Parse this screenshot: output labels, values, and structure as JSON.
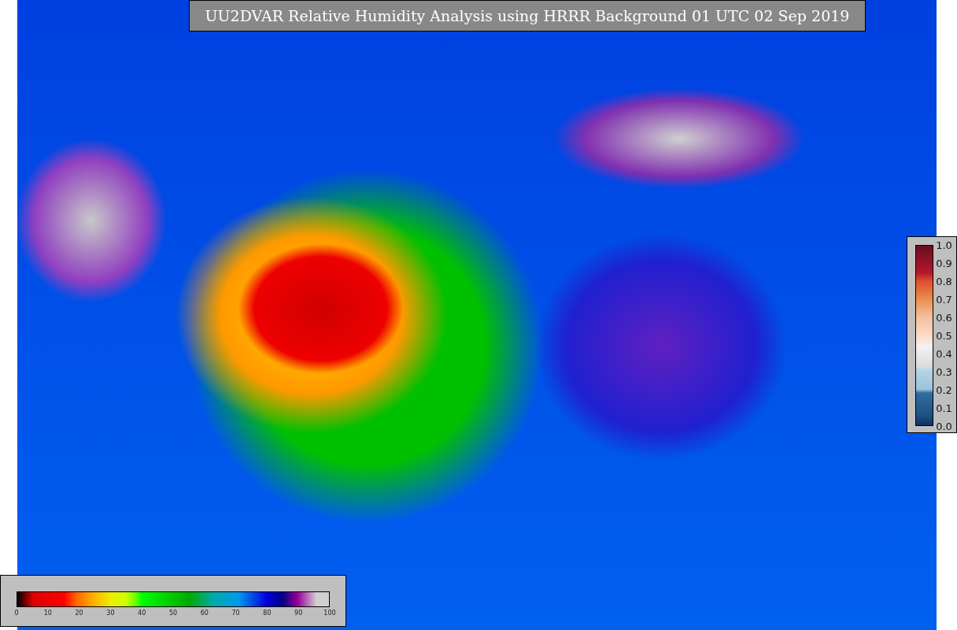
{
  "title": "UU2DVAR Relative Humidity Analysis using HRRR Background 01 UTC 02 Sep 2019",
  "humidity_colorbar": {
    "ticks": [
      "0",
      "10",
      "20",
      "30",
      "40",
      "50",
      "60",
      "70",
      "80",
      "90",
      "100"
    ]
  },
  "observation_colorbar": {
    "ticks": [
      "1.0",
      "0.9",
      "0.8",
      "0.7",
      "0.6",
      "0.5",
      "0.4",
      "0.3",
      "0.2",
      "0.1",
      "0.0"
    ]
  }
}
